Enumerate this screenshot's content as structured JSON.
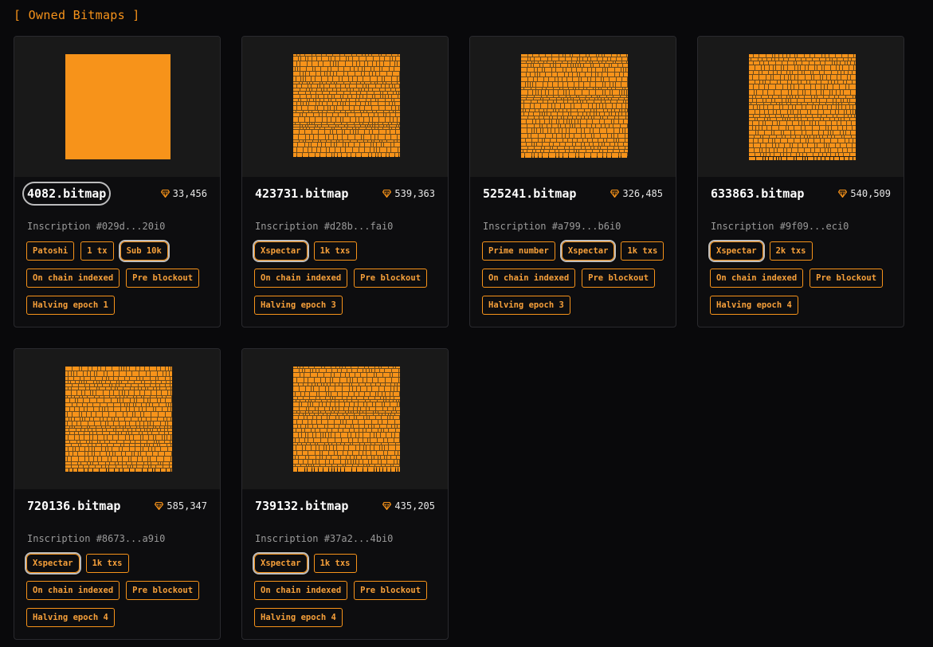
{
  "section_title": "[ Owned Bitmaps ]",
  "colors": {
    "accent": "#f7931a",
    "background": "#09090b",
    "card": "#0d0d0f",
    "thumb": "#191919"
  },
  "cards": [
    {
      "name": "4082.bitmap",
      "value": "33,456",
      "inscription": "Inscription #029d...20i0",
      "tags": [
        "Patoshi",
        "1 tx",
        "Sub 10k",
        "On chain indexed",
        "Pre blockout",
        "Halving epoch 1"
      ],
      "highlighted_tags": [
        "Sub 10k"
      ],
      "name_highlighted": true,
      "thumb": "solid"
    },
    {
      "name": "423731.bitmap",
      "value": "539,363",
      "inscription": "Inscription #d28b...fai0",
      "tags": [
        "Xspectar",
        "1k txs",
        "On chain indexed",
        "Pre blockout",
        "Halving epoch 3"
      ],
      "highlighted_tags": [
        "Xspectar"
      ],
      "name_highlighted": false,
      "thumb": "blocks"
    },
    {
      "name": "525241.bitmap",
      "value": "326,485",
      "inscription": "Inscription #a799...b6i0",
      "tags": [
        "Prime number",
        "Xspectar",
        "1k txs",
        "On chain indexed",
        "Pre blockout",
        "Halving epoch 3"
      ],
      "highlighted_tags": [
        "Xspectar"
      ],
      "name_highlighted": false,
      "thumb": "blocks"
    },
    {
      "name": "633863.bitmap",
      "value": "540,509",
      "inscription": "Inscription #9f09...eci0",
      "tags": [
        "Xspectar",
        "2k txs",
        "On chain indexed",
        "Pre blockout",
        "Halving epoch 4"
      ],
      "highlighted_tags": [
        "Xspectar"
      ],
      "name_highlighted": false,
      "thumb": "blocks"
    },
    {
      "name": "720136.bitmap",
      "value": "585,347",
      "inscription": "Inscription #8673...a9i0",
      "tags": [
        "Xspectar",
        "1k txs",
        "On chain indexed",
        "Pre blockout",
        "Halving epoch 4"
      ],
      "highlighted_tags": [
        "Xspectar"
      ],
      "name_highlighted": false,
      "thumb": "blocks"
    },
    {
      "name": "739132.bitmap",
      "value": "435,205",
      "inscription": "Inscription #37a2...4bi0",
      "tags": [
        "Xspectar",
        "1k txs",
        "On chain indexed",
        "Pre blockout",
        "Halving epoch 4"
      ],
      "highlighted_tags": [
        "Xspectar"
      ],
      "name_highlighted": false,
      "thumb": "blocks"
    }
  ]
}
